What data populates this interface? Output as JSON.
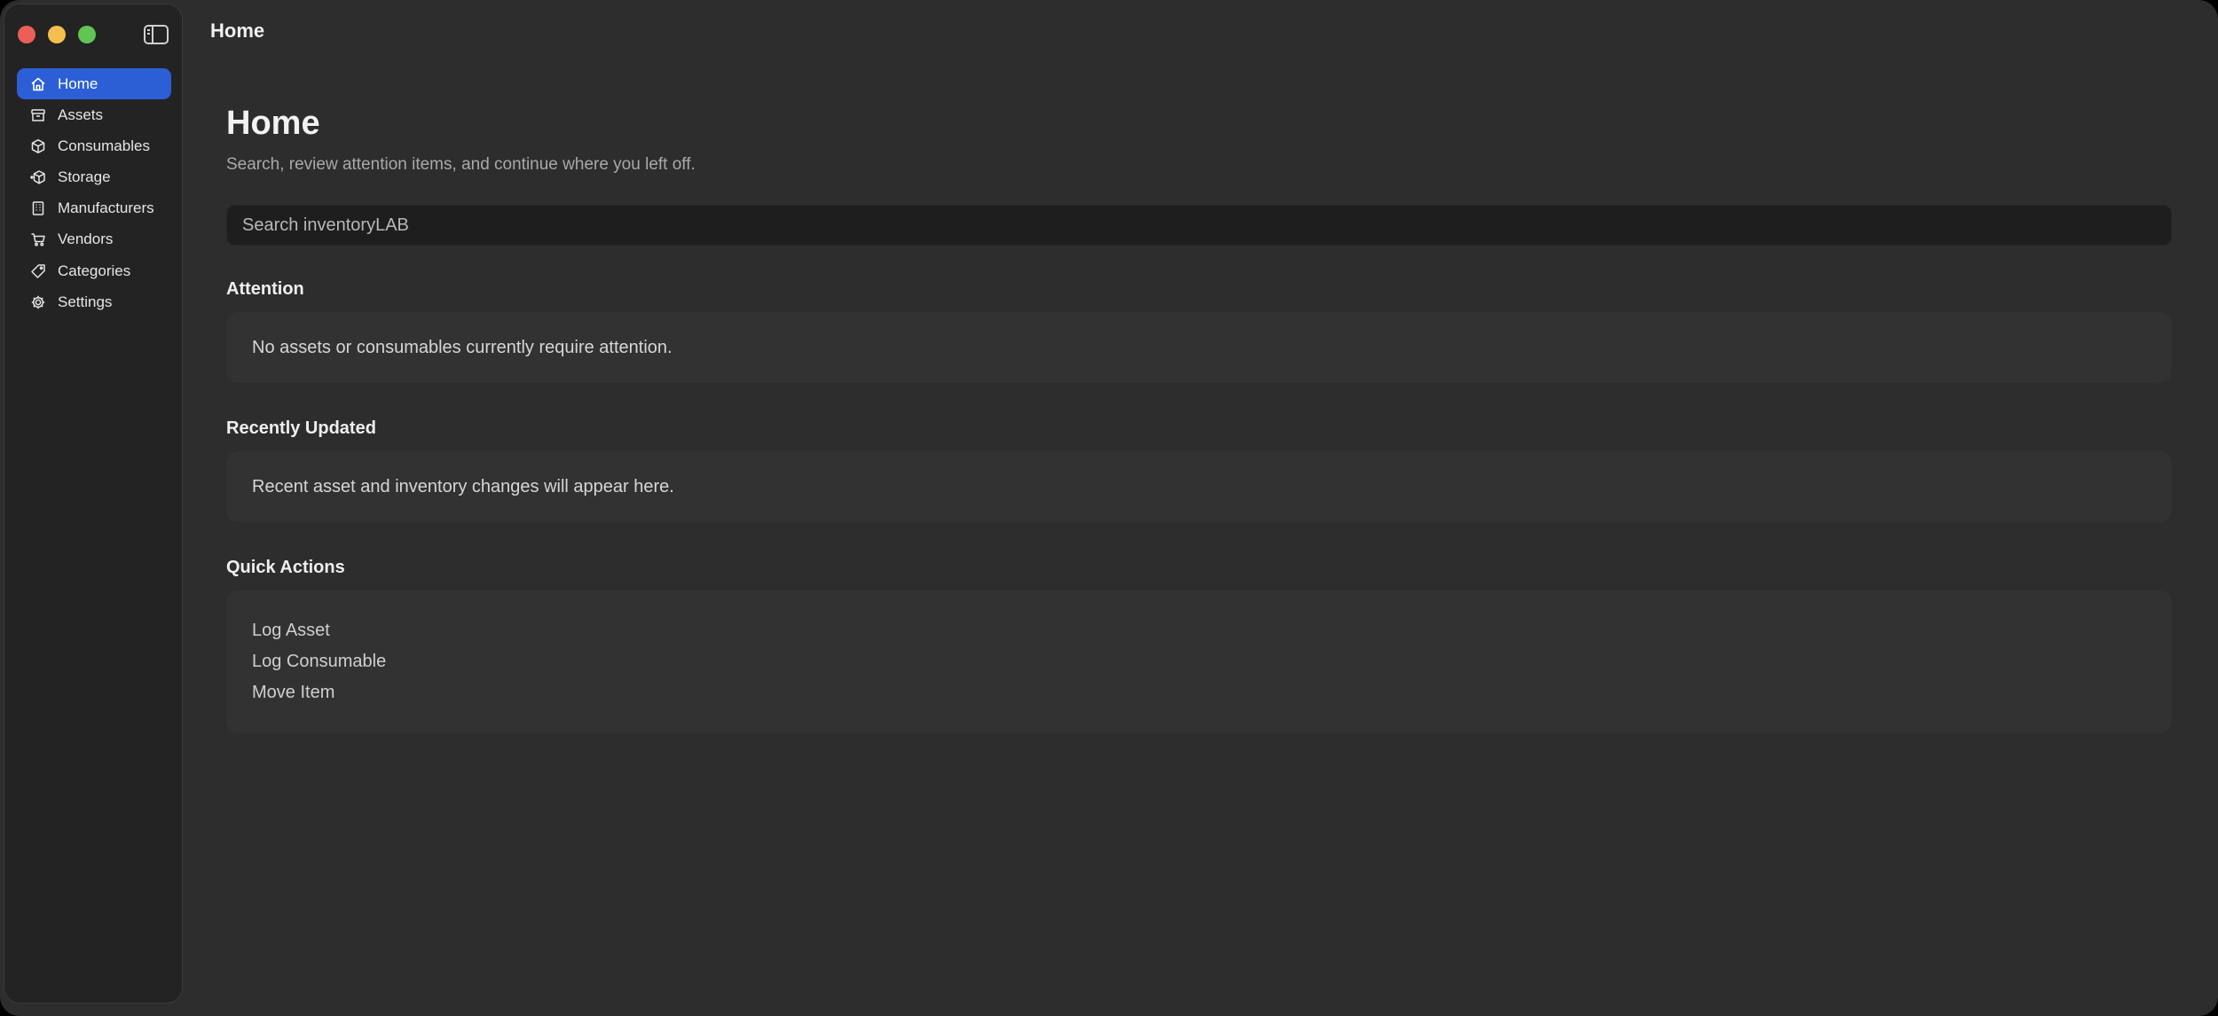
{
  "window": {
    "title": "Home"
  },
  "sidebar": {
    "items": [
      {
        "label": "Home",
        "icon": "house-icon",
        "active": true
      },
      {
        "label": "Assets",
        "icon": "archive-box-icon"
      },
      {
        "label": "Consumables",
        "icon": "package-icon"
      },
      {
        "label": "Storage",
        "icon": "storage-box-icon"
      },
      {
        "label": "Manufacturers",
        "icon": "building-icon"
      },
      {
        "label": "Vendors",
        "icon": "cart-icon"
      },
      {
        "label": "Categories",
        "icon": "tag-icon"
      },
      {
        "label": "Settings",
        "icon": "gear-icon"
      }
    ]
  },
  "main": {
    "title": "Home",
    "subtitle": "Search, review attention items, and continue where you left off.",
    "search": {
      "placeholder": "Search inventoryLAB",
      "value": ""
    },
    "attention": {
      "title": "Attention",
      "message": "No assets or consumables currently require attention."
    },
    "recent": {
      "title": "Recently Updated",
      "message": "Recent asset and inventory changes will appear here."
    },
    "quick_actions": {
      "title": "Quick Actions",
      "items": [
        "Log Asset",
        "Log Consumable",
        "Move Item"
      ]
    }
  },
  "colors": {
    "accent": "#2c5fd6",
    "window_bg": "#2d2d2d",
    "sidebar_bg": "#232323",
    "card_bg": "#323232",
    "close": "#ec5f56",
    "minimize": "#f4bf4f",
    "maximize": "#61c554"
  }
}
